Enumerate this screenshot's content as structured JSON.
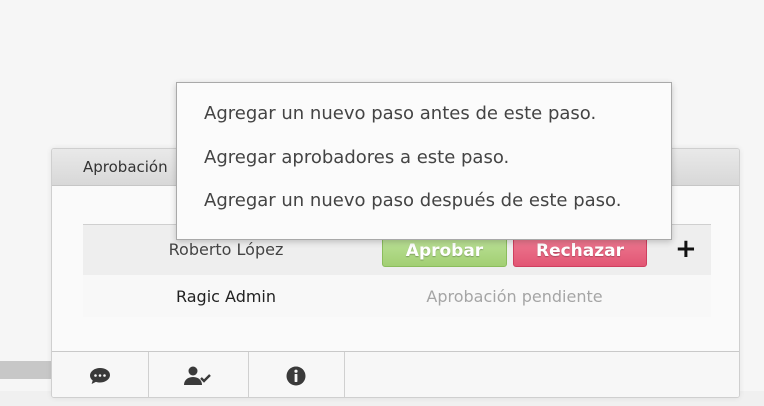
{
  "panel": {
    "title": "Aprobación"
  },
  "approvals": [
    {
      "approver": "Roberto López",
      "approve_label": "Aprobar",
      "reject_label": "Rechazar",
      "add_label": "+"
    },
    {
      "approver": "Ragic Admin",
      "status": "Aprobación pendiente"
    }
  ],
  "context_menu": {
    "items": [
      "Agregar un nuevo paso antes de este paso.",
      "Agregar aprobadores a este paso.",
      "Agregar un nuevo paso después de este paso."
    ]
  },
  "footer_tabs": [
    {
      "icon": "comment-icon"
    },
    {
      "icon": "user-check-icon"
    },
    {
      "icon": "info-icon"
    }
  ],
  "colors": {
    "approve": "#a2cf73",
    "reject": "#e25674",
    "pending_text": "#a5a5a5"
  }
}
